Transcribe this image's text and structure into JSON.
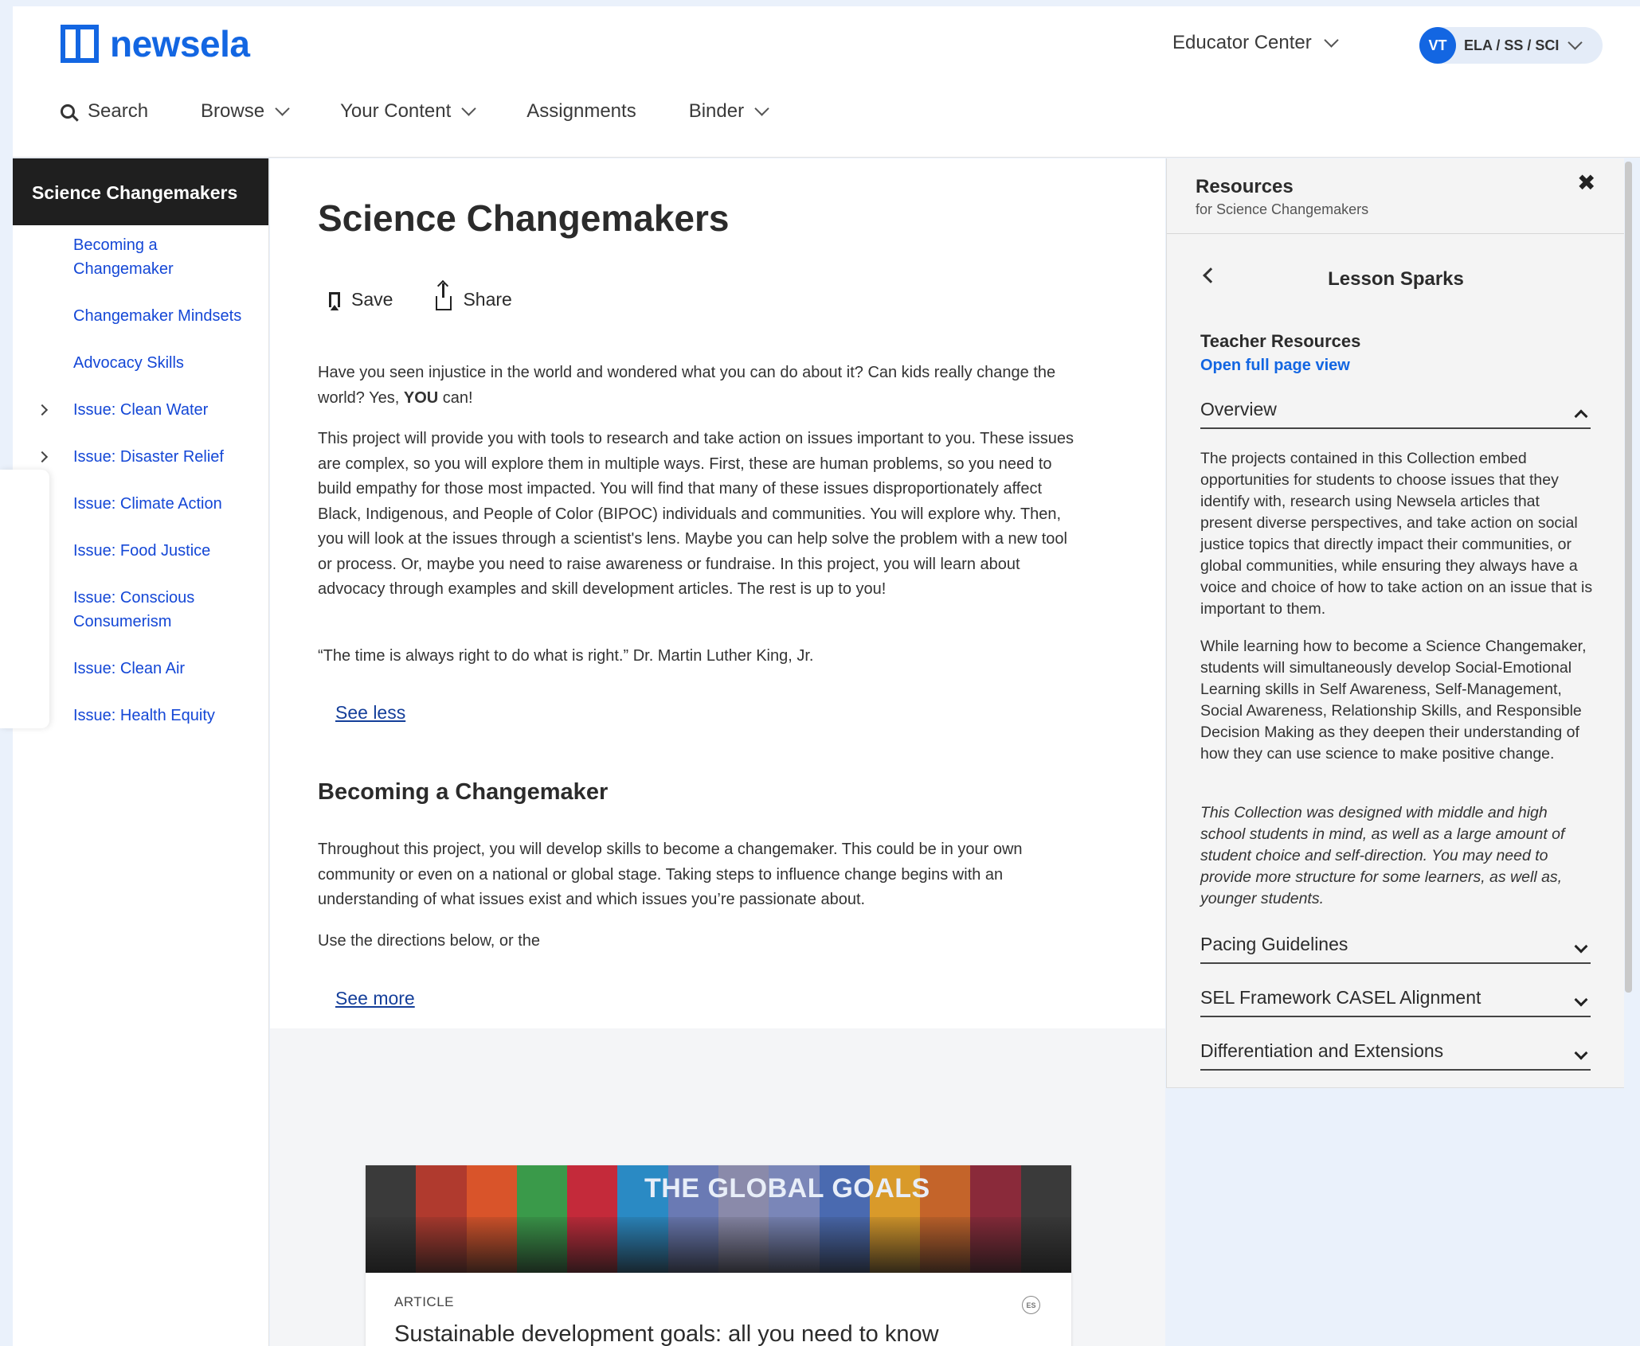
{
  "header": {
    "logo_text": "newsela",
    "educator_center": "Educator Center",
    "user_initials": "VT",
    "user_subjects": "ELA / SS / SCI",
    "nav": {
      "search": "Search",
      "browse": "Browse",
      "your_content": "Your Content",
      "assignments": "Assignments",
      "binder": "Binder"
    }
  },
  "sidebar": {
    "title": "Science Changemakers",
    "items": [
      {
        "label": "Becoming a Changemaker"
      },
      {
        "label": "Changemaker Mindsets"
      },
      {
        "label": "Advocacy Skills"
      },
      {
        "label": "Issue: Clean Water"
      },
      {
        "label": "Issue: Disaster Relief"
      },
      {
        "label": "Issue: Climate Action"
      },
      {
        "label": "Issue: Food Justice"
      },
      {
        "label": "Issue: Conscious Consumerism"
      },
      {
        "label": "Issue: Clean Air"
      },
      {
        "label": "Issue: Health Equity"
      }
    ]
  },
  "main": {
    "title": "Science Changemakers",
    "save_label": "Save",
    "share_label": "Share",
    "intro_p1_a": "Have you seen injustice in the world and wondered what you can do about it? Can kids really change the world? Yes, ",
    "intro_p1_bold": "YOU",
    "intro_p1_b": " can!",
    "intro_p2": "This project will provide you with tools to research and take action on issues important to you. These issues are complex, so you will explore them in multiple ways. First, these are human problems, so you need to build empathy for those most impacted. You will find that many of these issues disproportionately affect Black, Indigenous, and People of Color (BIPOC) individuals and communities. You will explore why. Then, you will look at the issues through a scientist's lens. Maybe you can help solve the problem with a new tool or process. Or, maybe you need to raise awareness or fundraise. In this project, you will learn about advocacy through examples and skill development articles. The rest is up to you!",
    "quote": "“The time is always right to do what is right.” Dr. Martin Luther King, Jr.",
    "see_less": "See less",
    "section_title": "Becoming a Changemaker",
    "section_p1": "Throughout this project, you will develop skills to become a changemaker. This could be in your own community or even on a national or global stage. Taking steps to influence change begins with an understanding of what issues exist and which issues you’re passionate about.",
    "section_p2": "Use the directions below, or the",
    "see_more": "See more",
    "card": {
      "image_title": "THE GLOBAL GOALS",
      "type": "ARTICLE",
      "badge": "ES",
      "title": "Sustainable development goals: all you need to know"
    }
  },
  "panel": {
    "title": "Resources",
    "subtitle": "for Science Changemakers",
    "close_symbol": "✖",
    "lesson_title": "Lesson Sparks",
    "teacher_resources": "Teacher Resources",
    "open_full": "Open full page view",
    "overview": "Overview",
    "overview_p1": "The projects contained in this Collection embed opportunities for students to choose issues that they identify with, research using Newsela articles that present diverse perspectives, and take action on social justice topics that directly impact their communities, or global communities, while ensuring they always have a voice and choice of how to take action on an issue that is important to them.",
    "overview_p2": "While learning how to become a Science Changemaker, students will simultaneously develop Social-Emotional Learning skills in Self Awareness, Self-Management, Social Awareness, Relationship Skills, and Responsible Decision Making as they deepen their understanding of how they can use science to make positive change.",
    "overview_p3": "This Collection was designed with middle and high school students in mind, as well as a large amount of student choice and self-direction. You may need to provide more structure for some learners, as well as, younger students.",
    "pacing": "Pacing Guidelines",
    "sel": "SEL Framework CASEL Alignment",
    "diff": "Differentiation and Extensions"
  },
  "colors": {
    "brand_blue": "#1366e2",
    "link_blue": "#1447d6",
    "sidebar_dark": "#1f1f1f"
  }
}
